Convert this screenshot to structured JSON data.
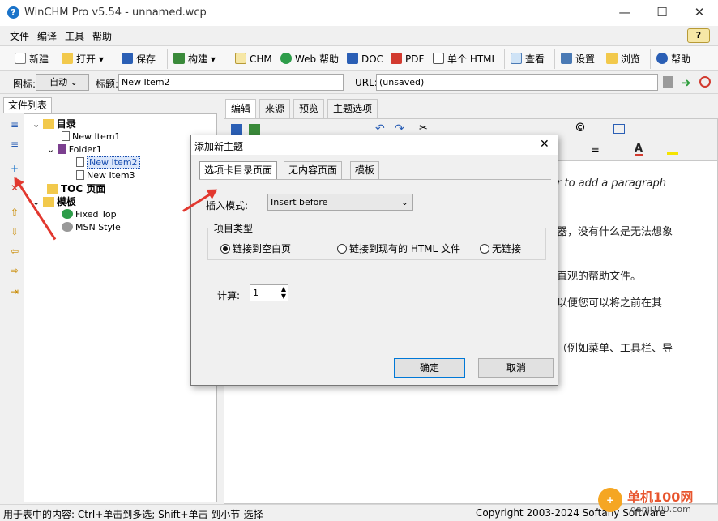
{
  "app": {
    "title": "WinCHM Pro v5.54 - unnamed.wcp"
  },
  "menu": [
    "文件",
    "编译",
    "工具",
    "帮助"
  ],
  "toolbar": {
    "new": "新建",
    "open": "打开",
    "save": "保存",
    "build": "构建",
    "chm": "CHM",
    "web": "Web 帮助",
    "doc": "DOC",
    "pdf": "PDF",
    "single": "单个 HTML",
    "view": "查看",
    "settings": "设置",
    "browse": "浏览",
    "help": "帮助"
  },
  "props": {
    "icon_label": "图标:",
    "icon_value": "自动",
    "title_label": "标题:",
    "title_value": "New Item2",
    "url_label": "URL:",
    "url_value": "(unsaved)"
  },
  "left": {
    "tab": "文件列表",
    "tree": [
      {
        "label": "目录",
        "bold": true
      },
      {
        "label": "New Item1"
      },
      {
        "label": "Folder1"
      },
      {
        "label": "New Item2",
        "selected": true
      },
      {
        "label": "New Item3"
      },
      {
        "label": "TOC 页面",
        "bold": true
      },
      {
        "label": "模板",
        "bold": true
      },
      {
        "label": "Fixed Top"
      },
      {
        "label": "MSN Style"
      }
    ]
  },
  "right": {
    "tabs": [
      "编辑",
      "来源",
      "预览",
      "主题选项"
    ],
    "lines": [
      "er to add a paragraph",
      "器，没有什么是无法想象",
      "直观的帮助文件。",
      "以便您可以将之前在其",
      "（例如菜单、工具栏、导"
    ]
  },
  "dialog": {
    "title": "添加新主题",
    "tabs": [
      "选项卡目录页面",
      "无内容页面",
      "模板"
    ],
    "insert_label": "插入模式:",
    "insert_value": "Insert before",
    "group_label": "项目类型",
    "radios": [
      "链接到空白页",
      "链接到现有的 HTML 文件",
      "无链接"
    ],
    "count_label": "计算:",
    "count_value": "1",
    "ok": "确定",
    "cancel": "取消"
  },
  "status": {
    "left": "用于表中的内容: Ctrl+单击到多选; Shift+单击 到小节-选择",
    "right": "Copyright 2003-2024 Softany Software",
    "watermark": "单机100网",
    "watermark_sub": "danji100.com"
  },
  "colors": {
    "accent": "#0b6fd6",
    "arrow": "#e2382f",
    "folder": "#f2c94c"
  }
}
